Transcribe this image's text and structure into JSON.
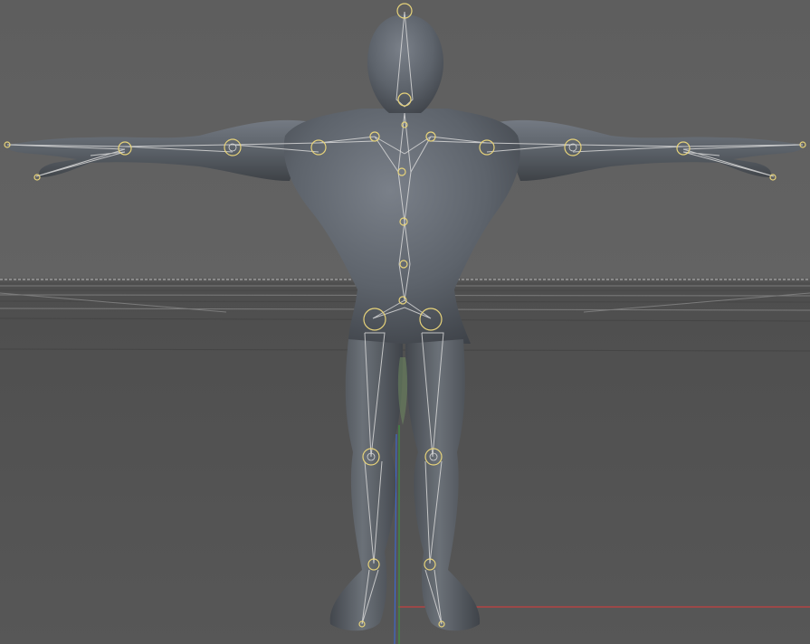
{
  "viewport": {
    "background_color": "#5d5d5d",
    "floor_color": "#505050",
    "mesh_color": "#5c6168",
    "bone_color": "#d8d8d8",
    "joint_color": "#e7d37a",
    "axis_x_color": "#e03a3a",
    "axis_y_color": "#3aa03a",
    "axis_z_color": "#3a6ae0"
  },
  "scene": {
    "object": "character-mesh",
    "rig": "skeleton-joints"
  }
}
